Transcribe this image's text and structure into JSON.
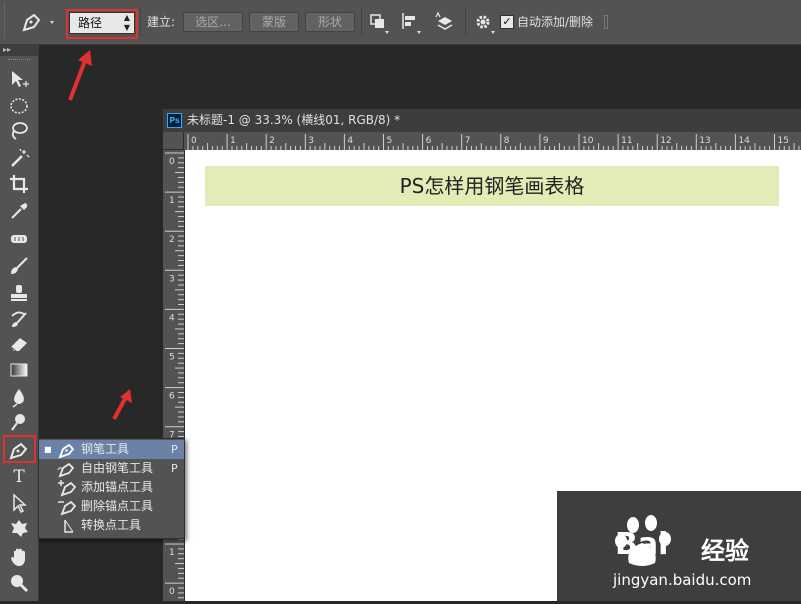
{
  "options_bar": {
    "mode_value": "路径",
    "make_label": "建立:",
    "selection_button": "选区...",
    "mask_button": "蒙版",
    "shape_button": "形状",
    "auto_add_delete_label": "自动添加/删除",
    "auto_add_delete_checked": true
  },
  "toolbar": {
    "tools": [
      "move-icon",
      "ellipse-marquee-icon",
      "lasso-icon",
      "magic-wand-icon",
      "crop-icon",
      "eyedropper-icon",
      "healing-brush-icon",
      "brush-icon",
      "clone-stamp-icon",
      "history-brush-icon",
      "eraser-icon",
      "gradient-icon",
      "blur-icon",
      "dodge-icon",
      "pen-icon",
      "type-icon",
      "path-selection-icon",
      "custom-shape-icon",
      "hand-icon",
      "zoom-icon"
    ],
    "type_tool_glyph": "T"
  },
  "flyout": {
    "items": [
      {
        "label": "钢笔工具",
        "key": "P",
        "selected": true
      },
      {
        "label": "自由钢笔工具",
        "key": "P",
        "selected": false
      },
      {
        "label": "添加锚点工具",
        "key": "",
        "selected": false
      },
      {
        "label": "删除锚点工具",
        "key": "",
        "selected": false
      },
      {
        "label": "转换点工具",
        "key": "",
        "selected": false
      }
    ]
  },
  "document": {
    "badge": "Ps",
    "title": "未标题-1 @ 33.3% (横线01, RGB/8) *",
    "hruler_labels": [
      "0",
      "1",
      "2",
      "3",
      "4",
      "5",
      "6",
      "7",
      "8",
      "9",
      "10",
      "11",
      "12",
      "13",
      "14",
      "15"
    ],
    "vruler_labels": [
      "0",
      "1",
      "2",
      "3",
      "4",
      "5",
      "6",
      "7",
      "8",
      "9",
      "1",
      "0"
    ],
    "banner_text": "PS怎样用钢笔画表格"
  },
  "watermark": {
    "brand": "Bai",
    "brand_tail": "经验",
    "url": "jingyan.baidu.com"
  },
  "colors": {
    "annotation_red": "#e03030",
    "banner_bg": "#e5ebb6",
    "flyout_highlight": "#6a81a8"
  }
}
